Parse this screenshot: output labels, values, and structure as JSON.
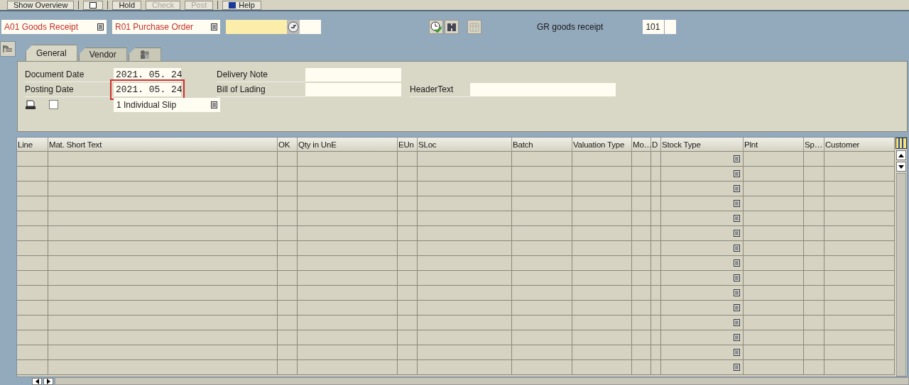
{
  "toolbar": [
    {
      "label": "Show Overview",
      "kind": "text",
      "disabled": false
    },
    {
      "kind": "icon"
    },
    {
      "label": "Hold",
      "kind": "text",
      "disabled": false
    },
    {
      "label": "Check",
      "kind": "text",
      "disabled": true
    },
    {
      "label": "Post",
      "kind": "text",
      "disabled": true
    },
    {
      "label": "Help",
      "kind": "help",
      "disabled": false
    }
  ],
  "transaction": {
    "action": "A01 Goods Receipt",
    "reference": "R01 Purchase Order",
    "movement_label": "GR goods receipt",
    "movement_type": "101"
  },
  "tabs": [
    {
      "label": "General",
      "kind": "text",
      "selected": true
    },
    {
      "label": "Vendor",
      "kind": "text",
      "selected": false
    },
    {
      "kind": "icon",
      "selected": false
    }
  ],
  "header": {
    "fields": [
      {
        "label": "Document Date",
        "value": "2021. 05. 24",
        "highlighted": false
      },
      {
        "label": "Posting Date",
        "value": "2021. 05. 24",
        "highlighted": true
      }
    ],
    "notes": [
      {
        "label": "Delivery Note"
      },
      {
        "label": "Bill of Lading"
      }
    ],
    "header_text": {
      "label": "HeaderText"
    },
    "print": {
      "checked": false,
      "slip": "1 Individual Slip"
    }
  },
  "table": {
    "columns": [
      {
        "label": "Line",
        "kind": "text"
      },
      {
        "label": "Mat. Short Text",
        "kind": "text"
      },
      {
        "label": "OK",
        "kind": "text"
      },
      {
        "label": "Qty in UnE",
        "kind": "text"
      },
      {
        "label": "EUn",
        "kind": "text"
      },
      {
        "label": "SLoc",
        "kind": "text"
      },
      {
        "label": "Batch",
        "kind": "text"
      },
      {
        "label": "Valuation Type",
        "kind": "text"
      },
      {
        "label": "Mo…",
        "kind": "text"
      },
      {
        "label": "D",
        "kind": "text"
      },
      {
        "label": "Stock Type",
        "kind": "dropdown"
      },
      {
        "label": "Plnt",
        "kind": "text"
      },
      {
        "label": "Sp…",
        "kind": "text"
      },
      {
        "label": "Customer",
        "kind": "text"
      }
    ],
    "rows": [
      {
        "kind": "empty"
      },
      {
        "kind": "empty"
      },
      {
        "kind": "empty"
      },
      {
        "kind": "empty"
      },
      {
        "kind": "empty"
      },
      {
        "kind": "empty"
      },
      {
        "kind": "empty"
      },
      {
        "kind": "empty"
      },
      {
        "kind": "empty"
      },
      {
        "kind": "empty"
      },
      {
        "kind": "empty"
      },
      {
        "kind": "empty"
      },
      {
        "kind": "empty"
      },
      {
        "kind": "empty"
      },
      {
        "kind": "empty"
      }
    ]
  }
}
